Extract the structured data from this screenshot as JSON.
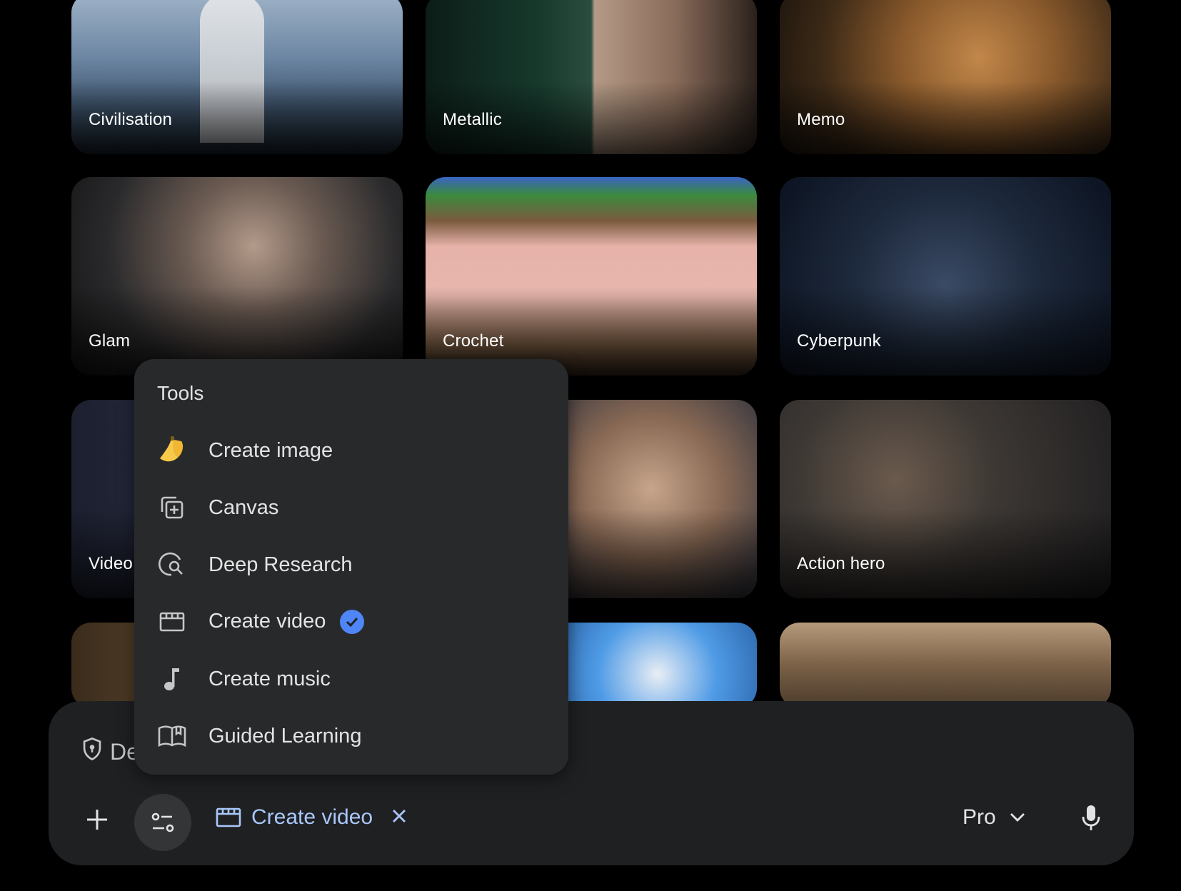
{
  "gallery": {
    "tiles": [
      {
        "label": "Civilisation"
      },
      {
        "label": "Metallic"
      },
      {
        "label": "Memo"
      },
      {
        "label": "Glam"
      },
      {
        "label": "Crochet"
      },
      {
        "label": "Cyberpunk"
      },
      {
        "label": "Video"
      },
      {
        "label": ""
      },
      {
        "label": "Action hero"
      }
    ]
  },
  "tools_menu": {
    "title": "Tools",
    "items": [
      {
        "label": "Create image",
        "icon": "banana-icon"
      },
      {
        "label": "Canvas",
        "icon": "canvas-icon"
      },
      {
        "label": "Deep Research",
        "icon": "deep-research-icon"
      },
      {
        "label": "Create video",
        "icon": "clapperboard-icon",
        "selected": true
      },
      {
        "label": "Create music",
        "icon": "music-note-icon"
      },
      {
        "label": "Guided Learning",
        "icon": "open-book-icon"
      }
    ]
  },
  "composer": {
    "hint_text": "De",
    "active_tool_chip": "Create video",
    "model_label": "Pro"
  },
  "colors": {
    "accent_blue": "#a8c7fa",
    "check_blue": "#4f86f7",
    "menu_bg": "#28292b",
    "composer_bg": "#1f2022"
  }
}
